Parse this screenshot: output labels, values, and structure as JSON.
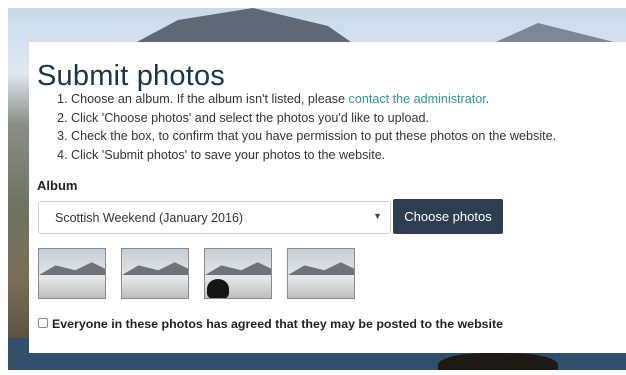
{
  "page": {
    "title": "Submit photos"
  },
  "steps": [
    {
      "before": "Choose an album. If the album isn't listed, please ",
      "link": "contact the administrator",
      "after": "."
    },
    {
      "before": "Click 'Choose photos' and select the photos you'd like to upload."
    },
    {
      "before": "Check the box, to confirm that you have permission to put these photos on the website."
    },
    {
      "before": "Click 'Submit photos' to save your photos to the website."
    }
  ],
  "album": {
    "label": "Album",
    "selected": "Scottish Weekend (January 2016)",
    "caret_glyph": "▼"
  },
  "buttons": {
    "choose_photos": "Choose photos"
  },
  "thumbnails": [
    {
      "kind": "snow-slope"
    },
    {
      "kind": "snow-hikers"
    },
    {
      "kind": "snow-dog"
    },
    {
      "kind": "snow-cloud"
    }
  ],
  "consent": {
    "label": "Everyone in these photos has agreed that they may be posted to the website",
    "checked": false
  },
  "colors": {
    "title": "#1f3346",
    "link": "#2a9c8b",
    "button_bg": "#2e3e50"
  }
}
